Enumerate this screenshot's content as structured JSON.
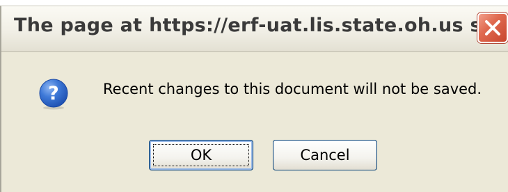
{
  "dialog": {
    "title": "The page at https://erf-uat.lis.state.oh.us s...",
    "message": "Recent changes to this document will not be saved.",
    "icon": "question-icon",
    "buttons": {
      "ok_label": "OK",
      "cancel_label": "Cancel"
    },
    "close_icon": "close-icon"
  },
  "colors": {
    "dialog_background": "#ece9d8",
    "close_button": "#e06a50",
    "question_icon": "#2a63c8",
    "default_button_border": "#003c74"
  }
}
